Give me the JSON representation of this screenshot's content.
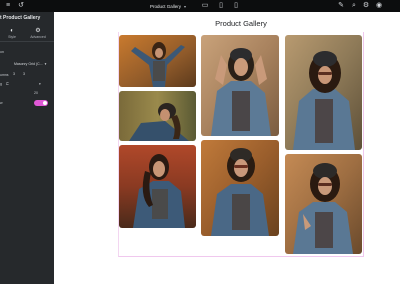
{
  "topbar": {
    "page_name": "Product Gallery",
    "icons": [
      "menu-icon",
      "history-icon",
      "desktop-icon",
      "tablet-icon",
      "mobile-icon",
      "tools-icon",
      "search-icon",
      "settings-icon",
      "preview-icon"
    ]
  },
  "sidebar": {
    "title": "t Product Gallery",
    "tabs": [
      {
        "label": "Style",
        "icon": "style-icon"
      },
      {
        "label": "Advanced",
        "icon": "gear-icon"
      }
    ],
    "section_label": "on",
    "select_value": "Masonry Grid (C...",
    "columns_label": "umns",
    "columns_value": "3",
    "columns_value_2": "3",
    "row2_label": "g",
    "row3_value": "20",
    "toggle_label": "w",
    "toggle_state": "on"
  },
  "canvas": {
    "heading": "Product Gallery",
    "photos": [
      {
        "alt": "woman-in-denim-jacket-arms-raised"
      },
      {
        "alt": "woman-reclining-beanie"
      },
      {
        "alt": "woman-autumn-portrait"
      },
      {
        "alt": "woman-beanie-hands-in-hair"
      },
      {
        "alt": "woman-sunglasses-smiling"
      },
      {
        "alt": "woman-beanie-curly-hair"
      },
      {
        "alt": "woman-beanie-sunglasses-autumn"
      }
    ]
  },
  "colors": {
    "topbar_bg": "#0c0d0e",
    "sidebar_bg": "#26292c",
    "accent": "#e058d6",
    "canvas_bg": "#ffffff"
  }
}
